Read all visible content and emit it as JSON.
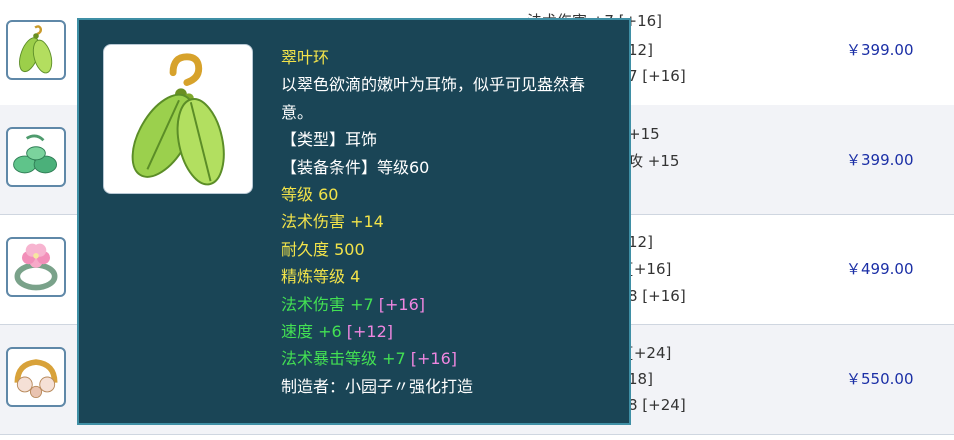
{
  "rows": [
    {
      "name": "shop-row-1",
      "thumb_icon": "leaf-earring-icon",
      "attrs": [
        "法术伤害 +7 [+16]",
        "12]",
        "7 [+16]"
      ],
      "price": "￥399.00"
    },
    {
      "name": "shop-row-2",
      "thumb_icon": "jade-leaf-earring-icon",
      "attrs": [
        "+15",
        "攻 +15"
      ],
      "price": "￥399.00"
    },
    {
      "name": "shop-row-3",
      "thumb_icon": "pink-flower-ring-icon",
      "attrs": [
        "12]",
        "[+16]",
        "8 [+16]"
      ],
      "price": "￥499.00"
    },
    {
      "name": "shop-row-4",
      "thumb_icon": "gold-pearl-earring-icon",
      "attrs": [
        "[+24]",
        "18]",
        "8 [+24]"
      ],
      "price": "￥550.00"
    }
  ],
  "tooltip": {
    "icon": "leaf-earring-icon",
    "name": "翠叶环",
    "description": "以翠色欲滴的嫩叶为耳饰，似乎可见盎然春意。",
    "type_line": "【类型】耳饰",
    "requirement_line": "【装备条件】等级60",
    "base_stats": [
      "等级 60",
      "法术伤害 +14",
      "耐久度 500",
      "精炼等级 4"
    ],
    "bonus_stats": [
      {
        "text": "法术伤害 +7",
        "extra": "[+16]"
      },
      {
        "text": "速度 +6",
        "extra": "[+12]"
      },
      {
        "text": "法术暴击等级 +7",
        "extra": "[+16]"
      }
    ],
    "maker": "制造者：小园子〃强化打造"
  },
  "colors": {
    "tooltip_bg": "#1a4556",
    "tooltip_border": "#3f8fa5",
    "yellow_text": "#f2e34a",
    "green_text": "#43e053",
    "pink_text": "#ef86e0",
    "price_text": "#1b2fa6"
  }
}
